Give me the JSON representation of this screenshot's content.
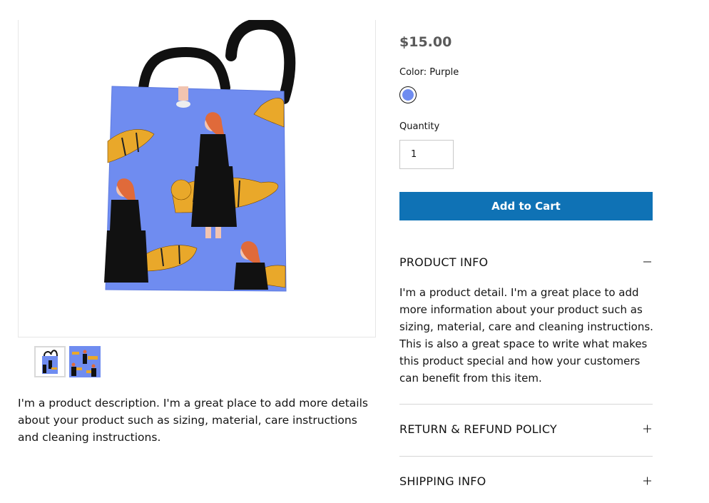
{
  "product": {
    "price": "$15.00",
    "color_label": "Color: Purple",
    "color_swatch": "#6f8cf0",
    "quantity_label": "Quantity",
    "quantity_value": "1",
    "add_to_cart_label": "Add to Cart",
    "description": "I'm a product description. I'm a great place to add more details about your product such as sizing, material, care instructions and cleaning instructions."
  },
  "accordion": [
    {
      "title": "PRODUCT INFO",
      "expanded": true,
      "body": "I'm a product detail. I'm a great place to add more information about your product such as sizing, material, care and cleaning instructions. This is also a great space to write what makes this product special and how your customers can benefit from this item."
    },
    {
      "title": "RETURN & REFUND POLICY",
      "expanded": false
    },
    {
      "title": "SHIPPING INFO",
      "expanded": false
    }
  ],
  "colors": {
    "button": "#0f72b5",
    "tote": "#6f8cf0",
    "tiger": "#e9a82a",
    "strap": "#111111"
  },
  "icons": {
    "collapse": "minus-icon",
    "expand": "plus-icon"
  }
}
